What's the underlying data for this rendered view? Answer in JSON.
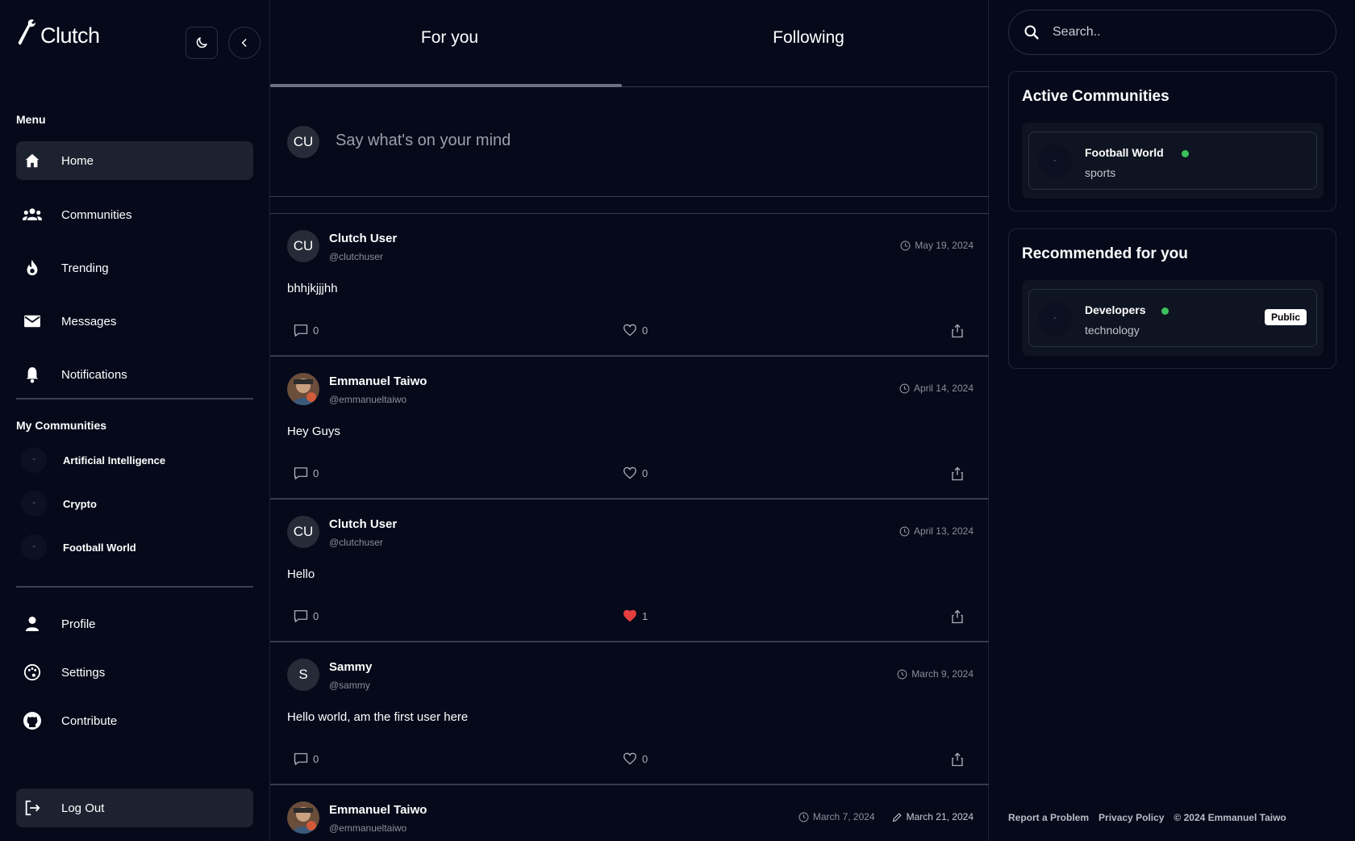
{
  "app": {
    "name": "Clutch"
  },
  "sidebar": {
    "menu_label": "Menu",
    "items": [
      {
        "label": "Home",
        "icon": "home-icon",
        "active": true
      },
      {
        "label": "Communities",
        "icon": "people-icon"
      },
      {
        "label": "Trending",
        "icon": "flame-icon"
      },
      {
        "label": "Messages",
        "icon": "mail-icon"
      },
      {
        "label": "Notifications",
        "icon": "bell-icon"
      }
    ],
    "my_communities_label": "My Communities",
    "communities": [
      {
        "label": "Artificial Intelligence"
      },
      {
        "label": "Crypto"
      },
      {
        "label": "Football World"
      }
    ],
    "bottom_items": [
      {
        "label": "Profile",
        "icon": "person-icon"
      },
      {
        "label": "Settings",
        "icon": "palette-icon"
      },
      {
        "label": "Contribute",
        "icon": "github-icon"
      }
    ],
    "logout_label": "Log Out"
  },
  "tabs": [
    {
      "label": "For you",
      "active": true
    },
    {
      "label": "Following"
    }
  ],
  "composer": {
    "avatar": "CU",
    "placeholder": "Say what's on your mind"
  },
  "posts": [
    {
      "avatar": "CU",
      "name": "Clutch User",
      "handle": "@clutchuser",
      "date": "May 19, 2024",
      "body": "bhhjkjjjhh",
      "comments": "0",
      "likes": "0",
      "liked": false
    },
    {
      "photo": true,
      "name": "Emmanuel Taiwo",
      "handle": "@emmanueltaiwo",
      "date": "April 14, 2024",
      "body": "Hey Guys",
      "comments": "0",
      "likes": "0",
      "liked": false
    },
    {
      "avatar": "CU",
      "name": "Clutch User",
      "handle": "@clutchuser",
      "date": "April 13, 2024",
      "body": "Hello",
      "comments": "0",
      "likes": "1",
      "liked": true
    },
    {
      "avatar": "S",
      "name": "Sammy",
      "handle": "@sammy",
      "date": "March 9, 2024",
      "body": "Hello world, am the first user here",
      "comments": "0",
      "likes": "0",
      "liked": false
    },
    {
      "photo": true,
      "name": "Emmanuel Taiwo",
      "handle": "@emmanueltaiwo",
      "date": "March 7, 2024",
      "edited": "March 21, 2024"
    }
  ],
  "search": {
    "placeholder": "Search.."
  },
  "active_communities": {
    "title": "Active Communities",
    "name": "Football World",
    "category": "sports"
  },
  "recommended": {
    "title": "Recommended for you",
    "name": "Developers",
    "category": "technology",
    "badge": "Public"
  },
  "footer": {
    "report": "Report a Problem",
    "privacy": "Privacy Policy",
    "copyright": "© 2024 Emmanuel Taiwo"
  },
  "colors": {
    "background": "#05091a",
    "online": "#3cc05c",
    "like": "#e53e3e"
  }
}
